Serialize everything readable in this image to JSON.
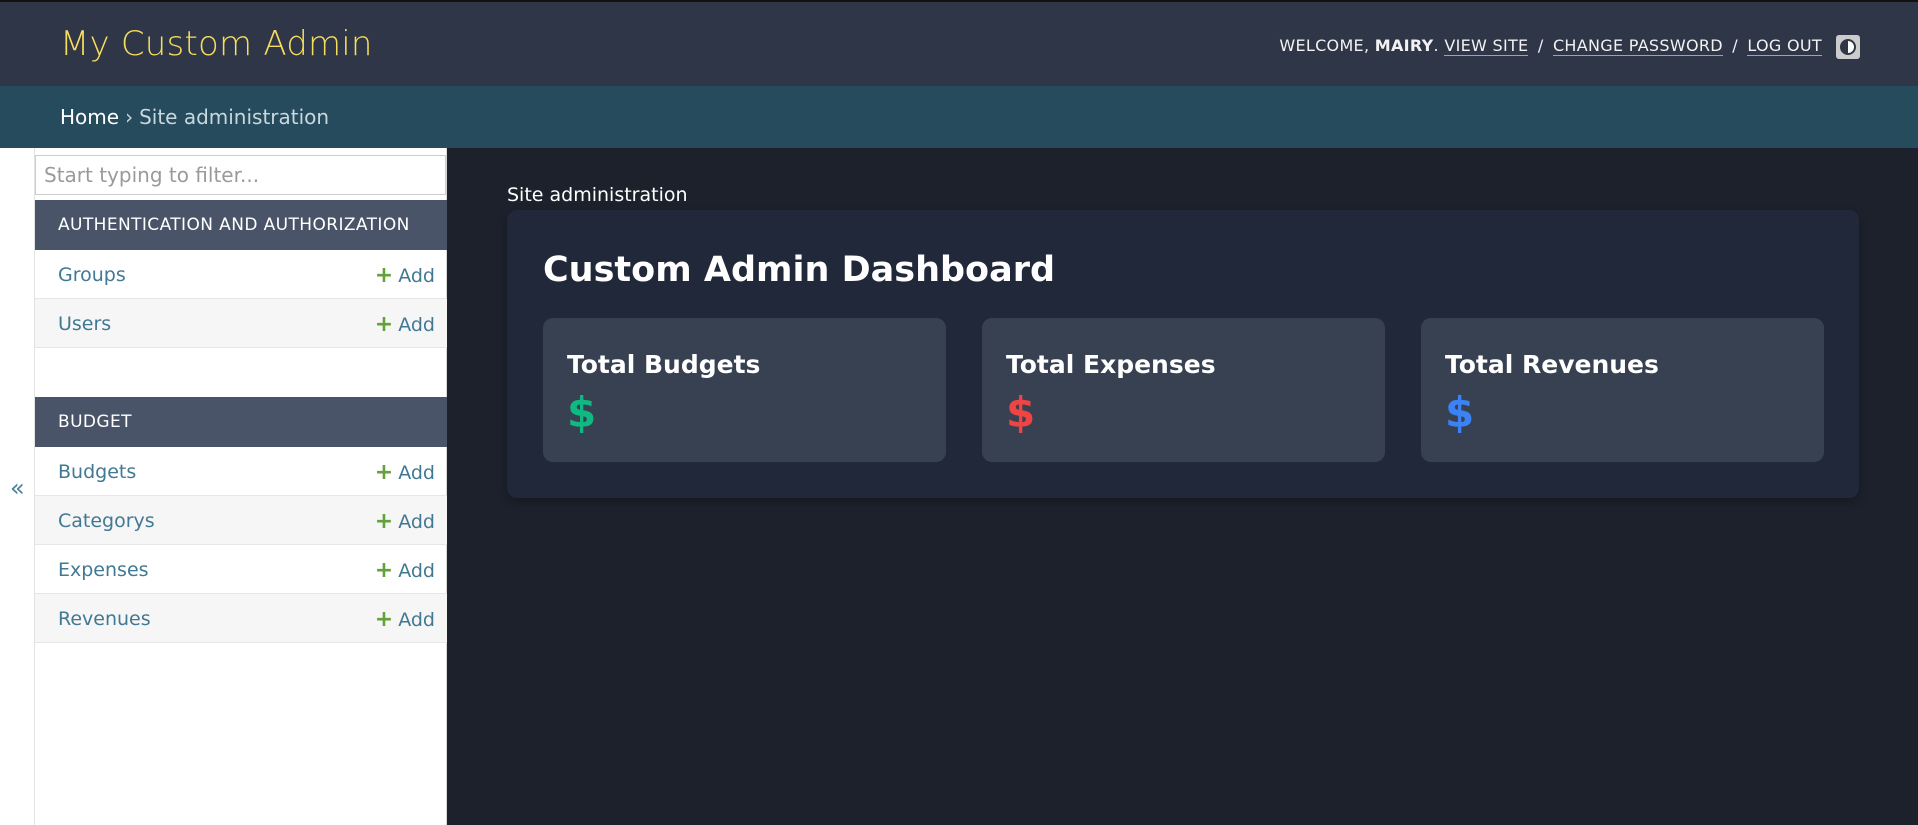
{
  "header": {
    "brand": "My Custom Admin",
    "welcome": "WELCOME,",
    "username": "MAIRY",
    "view_site": "VIEW SITE",
    "change_password": "CHANGE PASSWORD",
    "log_out": "LOG OUT",
    "separator": "/",
    "theme_icon": "theme-toggle-icon"
  },
  "breadcrumbs": {
    "home": "Home",
    "arrow": "›",
    "current": "Site administration"
  },
  "nav_toggle": {
    "symbol": "«"
  },
  "sidebar": {
    "filter_placeholder": "Start typing to filter...",
    "add_plus": "+",
    "add_label": "Add",
    "modules": [
      {
        "caption": "Authentication and Authorization",
        "items": [
          {
            "name": "Groups"
          },
          {
            "name": "Users"
          }
        ]
      },
      {
        "caption": "Budget",
        "items": [
          {
            "name": "Budgets"
          },
          {
            "name": "Categorys"
          },
          {
            "name": "Expenses"
          },
          {
            "name": "Revenues"
          }
        ]
      }
    ]
  },
  "main": {
    "section_label": "Site administration",
    "dashboard_title": "Custom Admin Dashboard",
    "cards": [
      {
        "title": "Total Budgets",
        "icon": "$",
        "icon_color": "#10b981"
      },
      {
        "title": "Total Expenses",
        "icon": "$",
        "icon_color": "#ef4444"
      },
      {
        "title": "Total Revenues",
        "icon": "$",
        "icon_color": "#3b82f6"
      }
    ]
  },
  "colors": {
    "header_bg": "#2f3647",
    "brand": "#f5dd5d",
    "breadcrumb_bg": "#264b5d",
    "module_caption_bg": "#4a5468",
    "link": "#417893",
    "add_plus": "#63a13a",
    "main_bg": "#1c212c",
    "panel_bg": "#212839",
    "card_bg": "#374152"
  }
}
